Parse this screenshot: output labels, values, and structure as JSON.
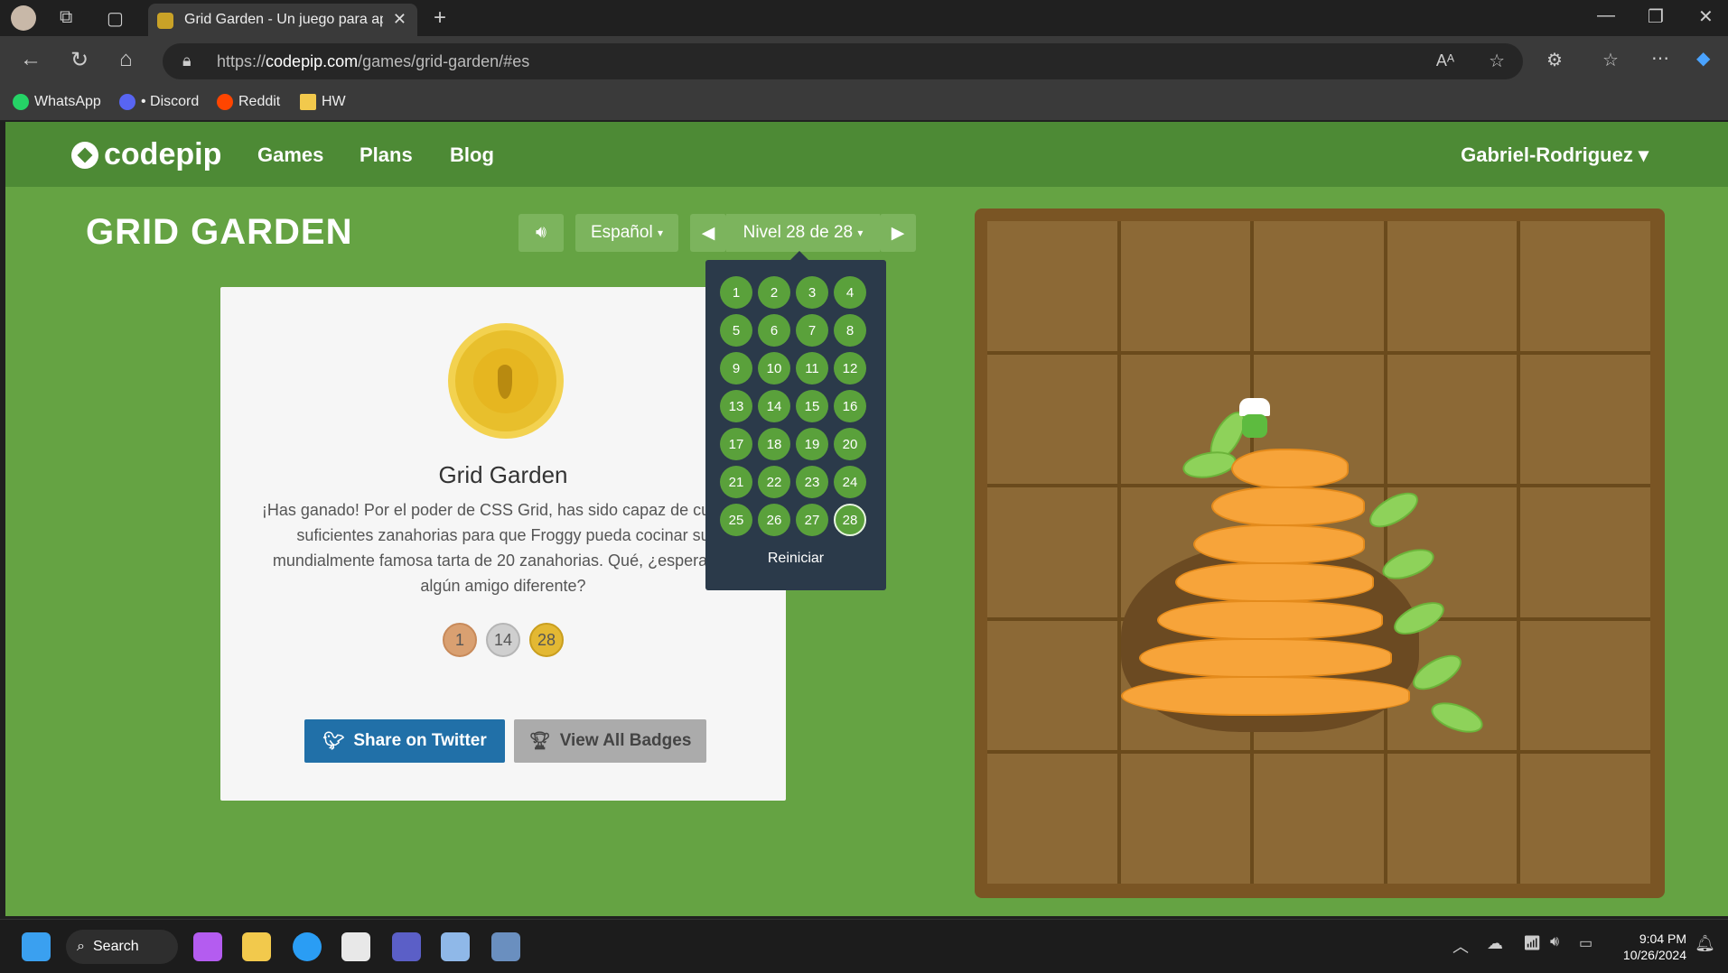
{
  "browser": {
    "tab_title": "Grid Garden - Un juego para apre",
    "url_prefix": "https://",
    "url_domain": "codepip.com",
    "url_path": "/games/grid-garden/#es",
    "bookmarks": [
      "WhatsApp",
      "• Discord",
      "Reddit",
      "HW"
    ]
  },
  "nav": {
    "logo": "codepip",
    "links": [
      "Games",
      "Plans",
      "Blog"
    ],
    "user": "Gabriel-Rodriguez"
  },
  "game": {
    "title": "GRID GARDEN",
    "language": "Español",
    "level_label": "Nivel 28 de 28",
    "levels": [
      "1",
      "2",
      "3",
      "4",
      "5",
      "6",
      "7",
      "8",
      "9",
      "10",
      "11",
      "12",
      "13",
      "14",
      "15",
      "16",
      "17",
      "18",
      "19",
      "20",
      "21",
      "22",
      "23",
      "24",
      "25",
      "26",
      "27",
      "28"
    ],
    "current_level": "28",
    "reset": "Reiniciar"
  },
  "card": {
    "title": "Grid Garden",
    "text": "¡Has ganado! Por el poder de CSS Grid, has sido capaz de cultivar suficientes zanahorias para que Froggy pueda cocinar su mundialmente famosa tarta de 20 zanahorias. Qué, ¿esperabas algún amigo diferente?",
    "badges": [
      {
        "label": "1",
        "color": "#d9a071"
      },
      {
        "label": "14",
        "color": "#cfcfcf"
      },
      {
        "label": "28",
        "color": "#e3b833"
      }
    ],
    "share_button": "Share on Twitter",
    "badges_button": "View All Badges"
  },
  "taskbar": {
    "search": "Search",
    "time": "9:04 PM",
    "date": "10/26/2024"
  },
  "colors": {
    "page_bg": "#65a343",
    "nav_bg": "#4d8a35",
    "twitter": "#2170a8",
    "dropdown_bg": "#2b3a4a",
    "level_circle": "#5aa13b"
  }
}
